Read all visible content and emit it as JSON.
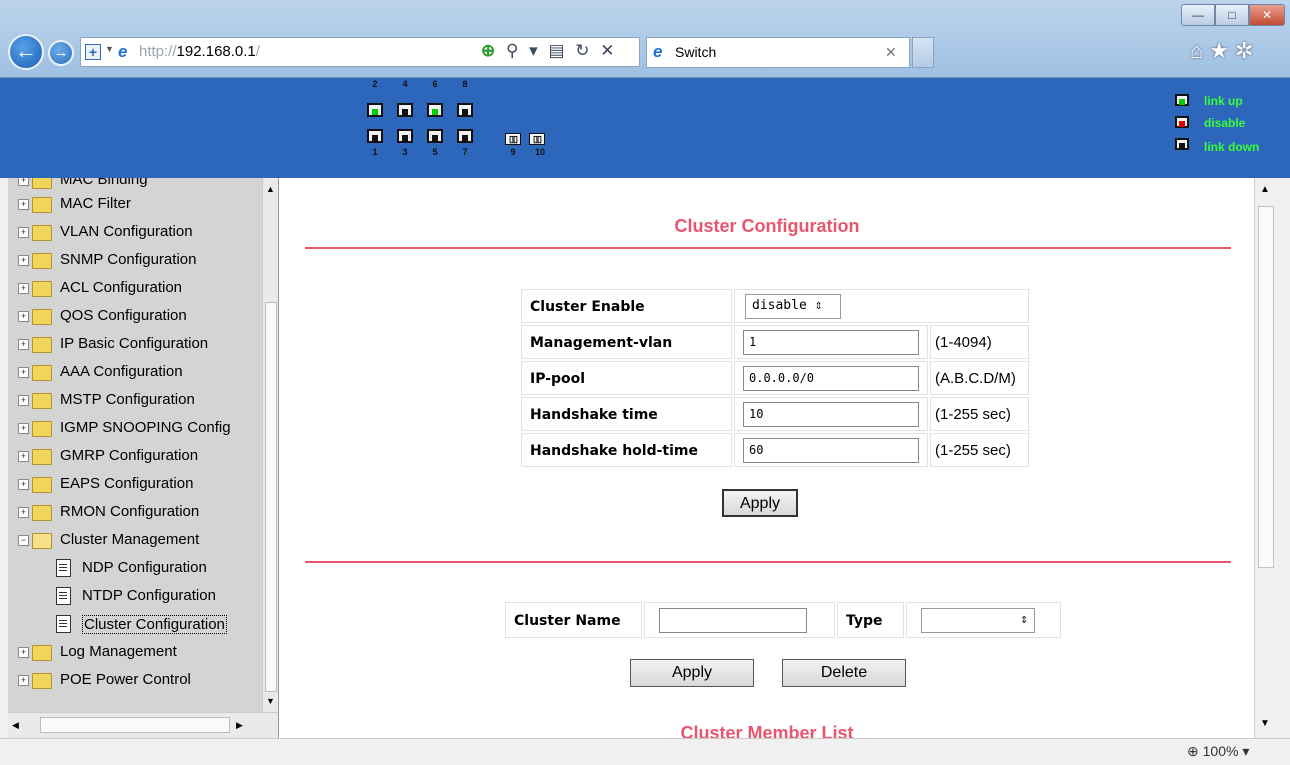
{
  "browser": {
    "url_scheme": "http://",
    "url_host": "192.168.0.1",
    "url_sep": "/",
    "tab_title": "Switch",
    "zoom": "100%"
  },
  "banner": {
    "top_port_numbers": [
      "2",
      "4",
      "6",
      "8"
    ],
    "bottom_port_numbers": [
      "1",
      "3",
      "5",
      "7"
    ],
    "sfp_numbers": [
      "9",
      "10"
    ],
    "legend": [
      {
        "label": "link up",
        "color": "#00d000"
      },
      {
        "label": "disable",
        "color": "#e00000"
      },
      {
        "label": "link down",
        "color": "#111111"
      }
    ]
  },
  "sidebar": {
    "items": [
      {
        "label": "MAC Binding",
        "type": "folder"
      },
      {
        "label": "MAC Filter",
        "type": "folder"
      },
      {
        "label": "VLAN Configuration",
        "type": "folder"
      },
      {
        "label": "SNMP Configuration",
        "type": "folder"
      },
      {
        "label": "ACL Configuration",
        "type": "folder"
      },
      {
        "label": "QOS Configuration",
        "type": "folder"
      },
      {
        "label": "IP Basic Configuration",
        "type": "folder"
      },
      {
        "label": "AAA Configuration",
        "type": "folder"
      },
      {
        "label": "MSTP Configuration",
        "type": "folder"
      },
      {
        "label": "IGMP SNOOPING Config",
        "type": "folder"
      },
      {
        "label": "GMRP Configuration",
        "type": "folder"
      },
      {
        "label": "EAPS Configuration",
        "type": "folder"
      },
      {
        "label": "RMON Configuration",
        "type": "folder"
      },
      {
        "label": "Cluster Management",
        "type": "folder-open"
      },
      {
        "label": "NDP Configuration",
        "type": "doc"
      },
      {
        "label": "NTDP Configuration",
        "type": "doc"
      },
      {
        "label": "Cluster Configuration",
        "type": "doc-selected"
      },
      {
        "label": "Log Management",
        "type": "folder"
      },
      {
        "label": "POE Power Control",
        "type": "folder"
      }
    ]
  },
  "main": {
    "title": "Cluster Configuration",
    "form": {
      "enable_label": "Cluster Enable",
      "enable_value": "disable",
      "mgmt_vlan_label": "Management-vlan",
      "mgmt_vlan_value": "1",
      "mgmt_vlan_hint": "(1-4094)",
      "ip_pool_label": "IP-pool",
      "ip_pool_value": "0.0.0.0/0",
      "ip_pool_hint": "(A.B.C.D/M)",
      "handshake_time_label": "Handshake time",
      "handshake_time_value": "10",
      "handshake_time_hint": "(1-255 sec)",
      "handshake_hold_label": "Handshake hold-time",
      "handshake_hold_value": "60",
      "handshake_hold_hint": "(1-255 sec)",
      "apply_label": "Apply"
    },
    "cluster_form": {
      "name_label": "Cluster Name",
      "name_value": "",
      "type_label": "Type",
      "type_value": "",
      "apply_label": "Apply",
      "delete_label": "Delete"
    },
    "member_list_title": "Cluster Member List"
  }
}
